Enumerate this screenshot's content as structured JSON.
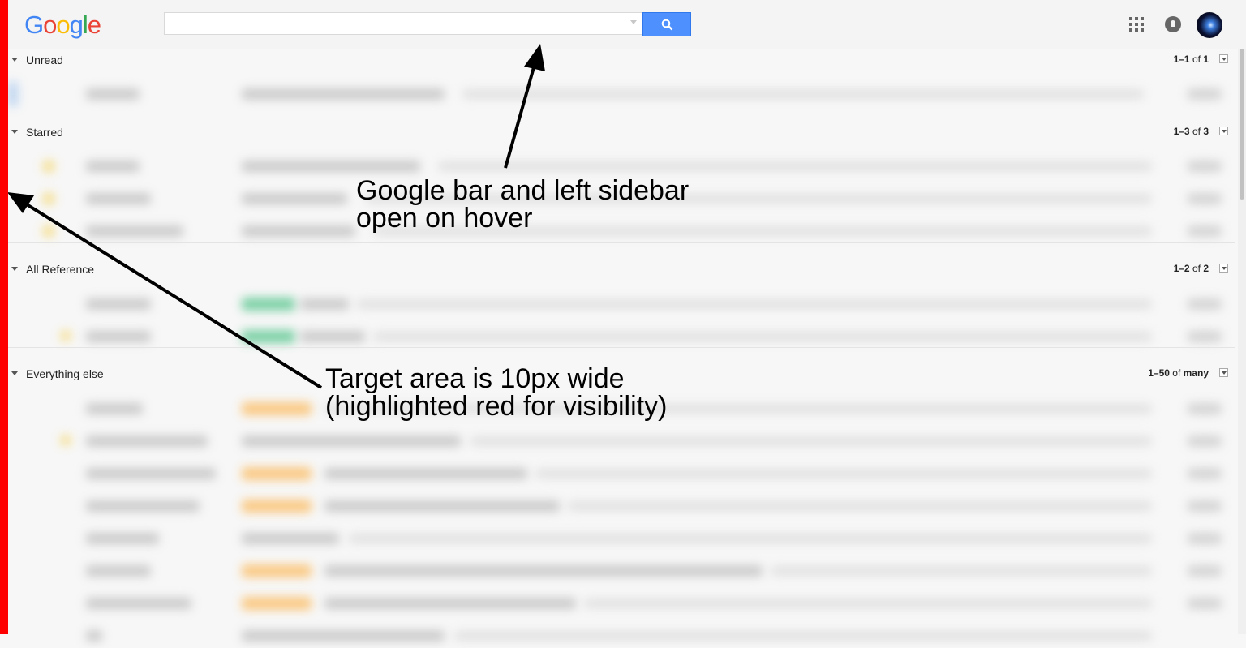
{
  "topbar": {
    "logo": "Google",
    "search_placeholder": ""
  },
  "sections": [
    {
      "title": "Unread",
      "range": "1–1",
      "of": "of",
      "total": "1"
    },
    {
      "title": "Starred",
      "range": "1–3",
      "of": "of",
      "total": "3"
    },
    {
      "title": "All Reference",
      "range": "1–2",
      "of": "of",
      "total": "2"
    },
    {
      "title": "Everything else",
      "range": "1–50",
      "of": "of",
      "total": "many"
    }
  ],
  "annotations": {
    "top_line1": "Google bar and left sidebar",
    "top_line2": "open on hover",
    "left_line1": "Target area is 10px wide",
    "left_line2": "(highlighted red for visibility)"
  },
  "colors": {
    "target_strip": "#ff0000",
    "search_button": "#4d90fe"
  },
  "icons": [
    "search-icon",
    "apps-grid-icon",
    "notifications-icon",
    "avatar"
  ]
}
